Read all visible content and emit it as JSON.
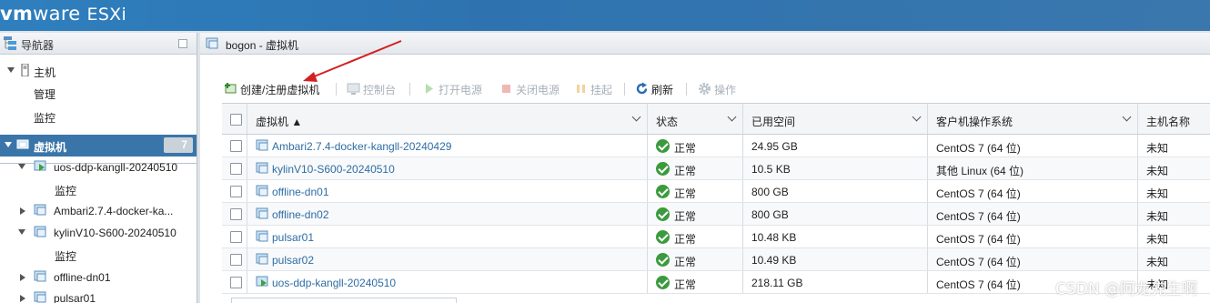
{
  "header": {
    "brand_vm": "vm",
    "brand_ware": "ware",
    "brand_product": "ESXi"
  },
  "navigator": {
    "title": "导航器",
    "host": {
      "label": "主机",
      "children": [
        "管理",
        "监控"
      ]
    },
    "vms": {
      "label": "虚拟机",
      "count": "7",
      "items": [
        {
          "label": "uos-ddp-kangll-20240510",
          "expanded": true,
          "child": "监控",
          "icon": "vm-running-icon"
        },
        {
          "label": "Ambari2.7.4-docker-ka...",
          "expanded": false,
          "icon": "vm-icon"
        },
        {
          "label": "kylinV10-S600-20240510",
          "expanded": true,
          "child": "监控",
          "icon": "vm-icon"
        },
        {
          "label": "offline-dn01",
          "expanded": false,
          "icon": "vm-icon"
        },
        {
          "label": "pulsar01",
          "expanded": false,
          "icon": "vm-icon"
        }
      ]
    }
  },
  "main": {
    "title": "bogon - 虚拟机",
    "toolbar": {
      "create": "创建/注册虚拟机",
      "console": "控制台",
      "power_on": "打开电源",
      "power_off": "关闭电源",
      "suspend": "挂起",
      "refresh": "刷新",
      "actions": "操作"
    },
    "columns": [
      "虚拟机 ▲",
      "状态",
      "已用空间",
      "客户机操作系统",
      "主机名称"
    ],
    "rows": [
      {
        "name": "Ambari2.7.4-docker-kangll-20240429",
        "status": "正常",
        "used": "24.95 GB",
        "os": "CentOS 7 (64 位)",
        "host": "未知",
        "running": false
      },
      {
        "name": "kylinV10-S600-20240510",
        "status": "正常",
        "used": "10.5 KB",
        "os": "其他 Linux (64 位)",
        "host": "未知",
        "running": false
      },
      {
        "name": "offline-dn01",
        "status": "正常",
        "used": "800 GB",
        "os": "CentOS 7 (64 位)",
        "host": "未知",
        "running": false
      },
      {
        "name": "offline-dn02",
        "status": "正常",
        "used": "800 GB",
        "os": "CentOS 7 (64 位)",
        "host": "未知",
        "running": false
      },
      {
        "name": "pulsar01",
        "status": "正常",
        "used": "10.48 KB",
        "os": "CentOS 7 (64 位)",
        "host": "未知",
        "running": false
      },
      {
        "name": "pulsar02",
        "status": "正常",
        "used": "10.49 KB",
        "os": "CentOS 7 (64 位)",
        "host": "未知",
        "running": false
      },
      {
        "name": "uos-ddp-kangll-20240510",
        "status": "正常",
        "used": "218.11 GB",
        "os": "CentOS 7 (64 位)",
        "host": "未知",
        "running": true
      }
    ]
  },
  "watermark": "CSDN @阿龙先生啊",
  "colors": {
    "header_blue": "#2f7fbe",
    "selected_blue": "#3a75a9",
    "link_blue": "#2e6da4",
    "ok_green": "#3c9a3e",
    "arrow_red": "#d32020"
  }
}
